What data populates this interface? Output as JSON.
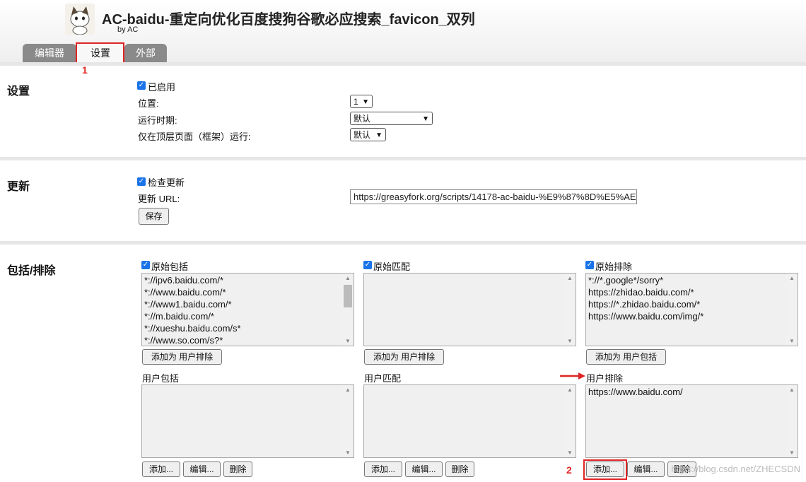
{
  "header": {
    "title": "AC-baidu-重定向优化百度搜狗谷歌必应搜索_favicon_双列",
    "byline": "by AC",
    "logo_icon": "cat-avatar-icon"
  },
  "tabs": [
    {
      "label": "编辑器",
      "active": false
    },
    {
      "label": "设置",
      "active": true
    },
    {
      "label": "外部",
      "active": false
    }
  ],
  "annotations": {
    "step1": "1",
    "step2": "2",
    "accent": "#e02424"
  },
  "settings": {
    "title": "设置",
    "enabled_label": "已启用",
    "position_label": "位置:",
    "position_value": "1",
    "runtime_label": "运行时期:",
    "runtime_value": "默认",
    "topframe_label": "仅在顶层页面（框架）运行:",
    "topframe_value": "默认"
  },
  "update": {
    "title": "更新",
    "check_label": "检查更新",
    "url_label": "更新 URL:",
    "url_value": "https://greasyfork.org/scripts/14178-ac-baidu-%E9%87%8D%E5%AE",
    "save_label": "保存"
  },
  "include": {
    "title": "包括/排除",
    "orig_include_label": "原始包括",
    "orig_include_items": [
      "*://ipv6.baidu.com/*",
      "*://www.baidu.com/*",
      "*://www1.baidu.com/*",
      "*://m.baidu.com/*",
      "*://xueshu.baidu.com/s*",
      "*://www.so.com/s?*"
    ],
    "orig_match_label": "原始匹配",
    "orig_exclude_label": "原始排除",
    "orig_exclude_items": [
      "*://*.google*/sorry*",
      "https://zhidao.baidu.com/*",
      "https://*.zhidao.baidu.com/*",
      "https://www.baidu.com/img/*"
    ],
    "add_as_user_exclude": "添加为 用户排除",
    "add_as_user_include": "添加为 用户包括",
    "user_include_label": "用户包括",
    "user_match_label": "用户匹配",
    "user_exclude_label": "用户排除",
    "user_exclude_items": [
      "https://www.baidu.com/"
    ],
    "add_btn": "添加...",
    "edit_btn": "编辑...",
    "delete_btn": "删除"
  },
  "watermark": "https://blog.csdn.net/ZHECSDN"
}
